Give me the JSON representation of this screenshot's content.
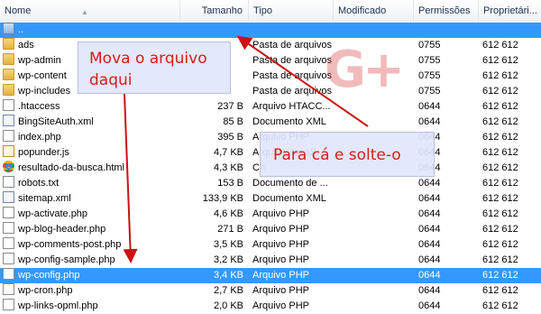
{
  "columns": {
    "name": "Nome",
    "size": "Tamanho",
    "type": "Tipo",
    "modified": "Modificado",
    "permissions": "Permissões",
    "owner": "Proprietári..."
  },
  "files": [
    {
      "name": "..",
      "size": "",
      "type": "",
      "perm": "",
      "owner": "",
      "icon": "up-folder-icon",
      "selected": true
    },
    {
      "name": "ads",
      "size": "",
      "type": "Pasta de arquivos",
      "perm": "0755",
      "owner": "612 612",
      "icon": "folder-icon"
    },
    {
      "name": "wp-admin",
      "size": "",
      "type": "Pasta de arquivos",
      "perm": "0755",
      "owner": "612 612",
      "icon": "folder-icon"
    },
    {
      "name": "wp-content",
      "size": "",
      "type": "Pasta de arquivos",
      "perm": "0755",
      "owner": "612 612",
      "icon": "folder-icon"
    },
    {
      "name": "wp-includes",
      "size": "",
      "type": "Pasta de arquivos",
      "perm": "0755",
      "owner": "612 612",
      "icon": "folder-icon"
    },
    {
      "name": ".htaccess",
      "size": "237 B",
      "type": "Arquivo HTACC...",
      "perm": "0644",
      "owner": "612 612",
      "icon": "file-icon"
    },
    {
      "name": "BingSiteAuth.xml",
      "size": "85 B",
      "type": "Documento XML",
      "perm": "0644",
      "owner": "612 612",
      "icon": "xml-file-icon"
    },
    {
      "name": "index.php",
      "size": "395 B",
      "type": "Arquivo PHP",
      "perm": "0644",
      "owner": "612 612",
      "icon": "file-icon"
    },
    {
      "name": "popunder.js",
      "size": "4,7 KB",
      "type": "Arquivo JavaS...",
      "perm": "0644",
      "owner": "612 612",
      "icon": "js-file-icon"
    },
    {
      "name": "resultado-da-busca.html",
      "size": "4,3 KB",
      "type": "Ch",
      "perm": "0644",
      "owner": "612 612",
      "icon": "chrome-icon"
    },
    {
      "name": "robots.txt",
      "size": "153 B",
      "type": "Documento de ...",
      "perm": "0644",
      "owner": "612 612",
      "icon": "file-icon"
    },
    {
      "name": "sitemap.xml",
      "size": "133,9 KB",
      "type": "Documento XML",
      "perm": "0644",
      "owner": "612 612",
      "icon": "xml-file-icon"
    },
    {
      "name": "wp-activate.php",
      "size": "4,6 KB",
      "type": "Arquivo PHP",
      "perm": "0644",
      "owner": "612 612",
      "icon": "file-icon"
    },
    {
      "name": "wp-blog-header.php",
      "size": "271 B",
      "type": "Arquivo PHP",
      "perm": "0644",
      "owner": "612 612",
      "icon": "file-icon"
    },
    {
      "name": "wp-comments-post.php",
      "size": "3,5 KB",
      "type": "Arquivo PHP",
      "perm": "0644",
      "owner": "612 612",
      "icon": "file-icon"
    },
    {
      "name": "wp-config-sample.php",
      "size": "3,2 KB",
      "type": "Arquivo PHP",
      "perm": "0644",
      "owner": "612 612",
      "icon": "file-icon"
    },
    {
      "name": "wp-config.php",
      "size": "3,4 KB",
      "type": "Arquivo PHP",
      "perm": "0644",
      "owner": "612 612",
      "icon": "file-icon",
      "selected": true
    },
    {
      "name": "wp-cron.php",
      "size": "2,7 KB",
      "type": "Arquivo PHP",
      "perm": "0644",
      "owner": "612 612",
      "icon": "file-icon"
    },
    {
      "name": "wp-links-opml.php",
      "size": "2,0 KB",
      "type": "Arquivo PHP",
      "perm": "0644",
      "owner": "612 612",
      "icon": "file-icon"
    }
  ],
  "annotations": {
    "move_from_line1": "Mova o arquivo",
    "move_from_line2": "daqui",
    "drop_here": "Para cá e solte-o",
    "arrow_color": "#cc1111"
  },
  "watermark": {
    "text": "G+",
    "icon": "gplus-logo"
  },
  "colors": {
    "selection": "#3399ff",
    "annotation_text": "#d81b1b"
  }
}
